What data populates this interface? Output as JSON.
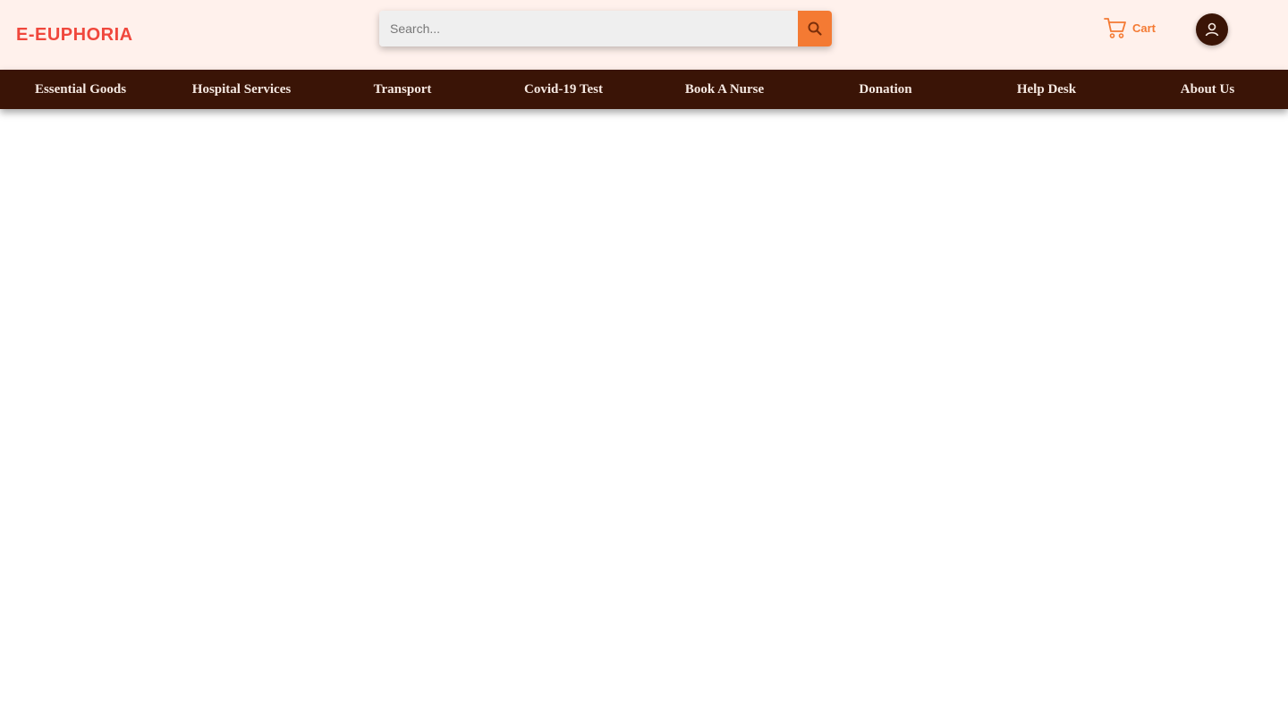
{
  "header": {
    "logo_text": "E-EUPHORIA",
    "search": {
      "placeholder": "Search...",
      "value": ""
    },
    "search_icon": "search-icon",
    "cart": {
      "icon": "cart-icon",
      "label": "Cart"
    },
    "avatar_icon": "user-icon"
  },
  "nav": {
    "items": [
      {
        "label": "Essential Goods"
      },
      {
        "label": "Hospital Services"
      },
      {
        "label": "Transport"
      },
      {
        "label": "Covid-19 Test"
      },
      {
        "label": "Book A Nurse"
      },
      {
        "label": "Donation"
      },
      {
        "label": "Help Desk"
      },
      {
        "label": "About Us"
      }
    ]
  },
  "colors": {
    "topbar_bg": "#fff1ec",
    "nav_bg": "#3a1406",
    "accent": "#f47a33",
    "logo": "#f0473c"
  }
}
